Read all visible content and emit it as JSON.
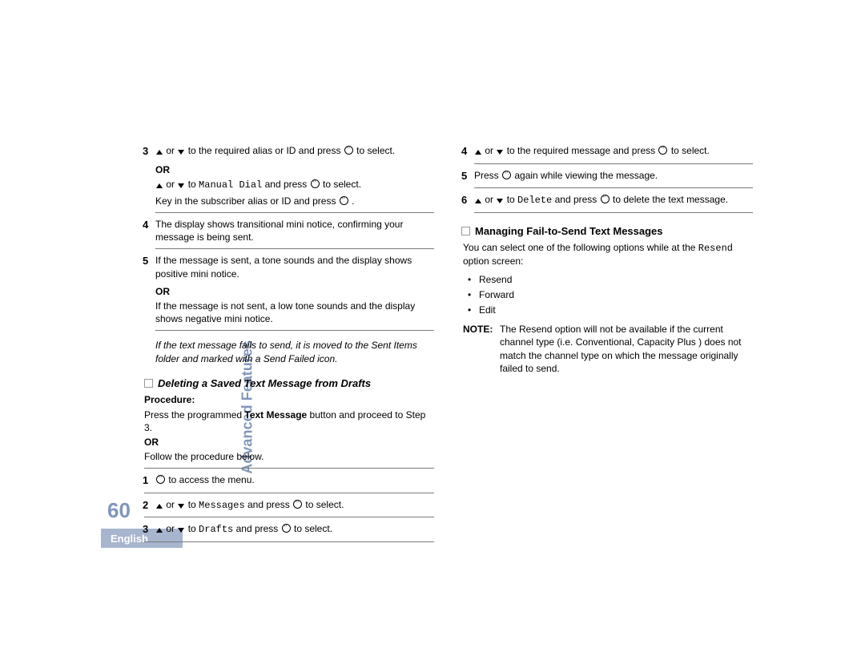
{
  "page_number": "60",
  "section_label": "Advanced Features",
  "language": "English",
  "left": {
    "step3a": " to the required alias or ID and press ",
    "step3a_end": " to select.",
    "or1": "OR",
    "step3b_mid": " to ",
    "step3b_cmd": "Manual Dial",
    "step3b_after": " and press ",
    "step3b_end": " to select.",
    "step3c": "Key in the subscriber alias or ID and press ",
    "step3c_end": ".",
    "step4": "The display shows transitional mini notice, confirming your message is being sent.",
    "step5a": "If the message is sent, a tone sounds and the display shows positive mini notice.",
    "or2": "OR",
    "step5b": "If the message is not sent, a low tone sounds and the display shows negative mini notice.",
    "fail_note": "If the text message fails to send, it is moved to the Sent Items folder and marked with a Send Failed icon.",
    "del_heading": "Deleting a Saved Text Message from Drafts",
    "proc_label": "Procedure:",
    "proc_text": "Press the programmed Text Message button and proceed to Step 3.",
    "proc_pre": "Press the programmed ",
    "proc_bold": "Text Message",
    "proc_post": " button and proceed to Step 3.",
    "or3": "OR",
    "follow": "Follow the procedure below.",
    "d_step1": " to access the menu.",
    "d_step2_mid": " to ",
    "d_step2_cmd": "Messages",
    "d_step2_after": " and press ",
    "d_step2_end": " to select.",
    "d_step3_mid": " to ",
    "d_step3_cmd": "Drafts",
    "d_step3_after": " and press ",
    "d_step3_end": " to select."
  },
  "right": {
    "r_step4": " to the required message and press ",
    "r_step4_end": " to select.",
    "r_step5a": "Press ",
    "r_step5b": " again while viewing the message.",
    "r_step6_mid": " to ",
    "r_step6_cmd": "Delete",
    "r_step6_after": " and press ",
    "r_step6_end": " to delete the text message.",
    "heading": "Managing Fail-to-Send Text Messages",
    "intro_a": "You can select one of the following options while at the ",
    "intro_cmd": "Resend",
    "intro_b": " option screen:",
    "bullets": [
      "Resend",
      "Forward",
      "Edit"
    ],
    "note_label": "NOTE:",
    "note_body": "The Resend option will not be available if the current channel type (i.e. Conventional, Capacity Plus ) does not match the channel type on which the message originally failed to send."
  },
  "nums": {
    "n1": "1",
    "n2": "2",
    "n3": "3",
    "n4": "4",
    "n5": "5",
    "n6": "6"
  }
}
